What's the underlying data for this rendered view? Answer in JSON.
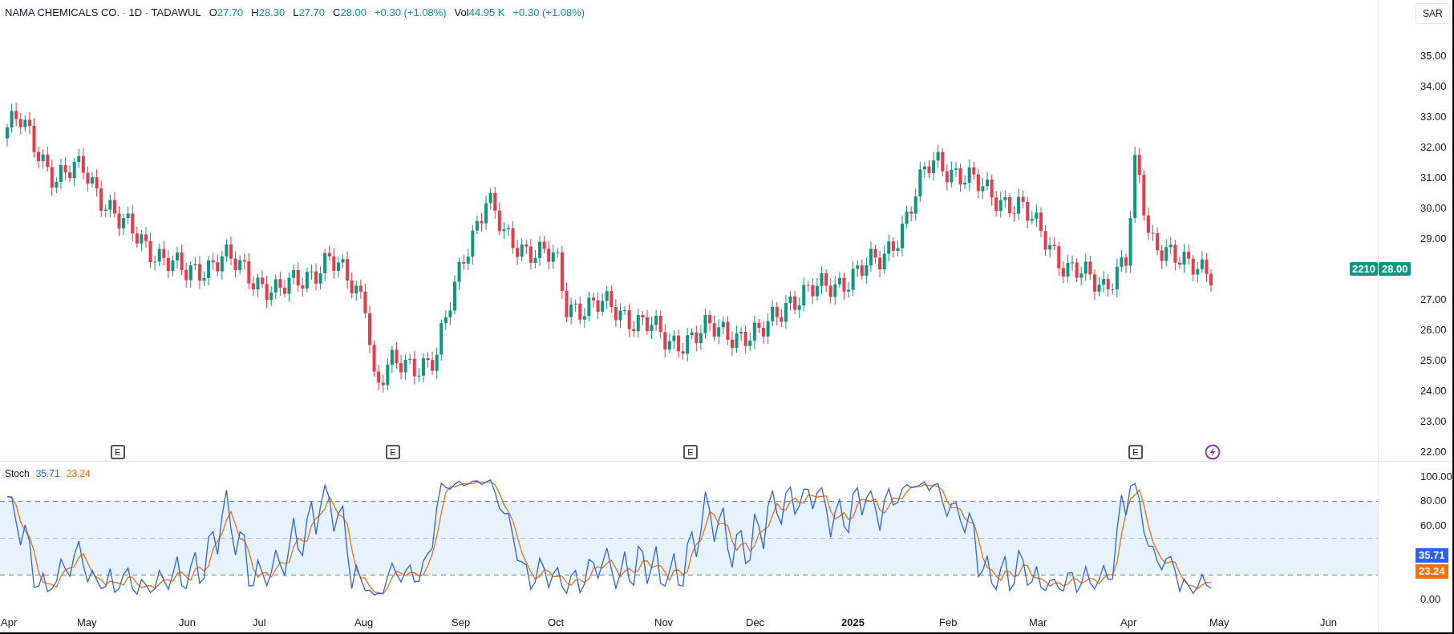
{
  "header": {
    "title": "NAMA CHEMICALS CO. · 1D · TADAWUL",
    "ohlc": [
      {
        "label": "O",
        "value": "27.70"
      },
      {
        "label": "H",
        "value": "28.30"
      },
      {
        "label": "L",
        "value": "27.70"
      },
      {
        "label": "C",
        "value": "28.00"
      }
    ],
    "change": "+0.30 (+1.08%)",
    "volume": {
      "label": "Vol",
      "value": "44.95 K",
      "change": "+0.30 (+1.08%)"
    }
  },
  "currency_button": "SAR",
  "price_axis": {
    "ticks": [
      "35.00",
      "34.00",
      "33.00",
      "32.00",
      "31.00",
      "30.00",
      "29.00",
      "27.00",
      "26.00",
      "25.00",
      "24.00",
      "23.00",
      "22.00"
    ],
    "last_price": {
      "price": "28.00",
      "volume": "2210",
      "color": "#089981"
    }
  },
  "events": [
    {
      "label": "E"
    },
    {
      "label": "E"
    },
    {
      "label": "E"
    },
    {
      "label": "E"
    }
  ],
  "stochastic": {
    "title": "Stoch",
    "k": {
      "value": "35.71",
      "color": "#2962ff"
    },
    "d": {
      "value": "23.24",
      "color": "#ff6d00"
    },
    "ticks": [
      "100.00",
      "80.00",
      "60.00",
      "0.00"
    ],
    "badges": [
      {
        "value": "35.71",
        "color": "#2962ff"
      },
      {
        "value": "23.24",
        "color": "#ff6d00"
      }
    ]
  },
  "x_axis": {
    "labels": [
      {
        "text": "Apr",
        "kind": "month"
      },
      {
        "text": "May",
        "kind": "month"
      },
      {
        "text": "Jun",
        "kind": "month"
      },
      {
        "text": "Jul",
        "kind": "month"
      },
      {
        "text": "Aug",
        "kind": "month"
      },
      {
        "text": "Sep",
        "kind": "month"
      },
      {
        "text": "Oct",
        "kind": "month"
      },
      {
        "text": "Nov",
        "kind": "month"
      },
      {
        "text": "Dec",
        "kind": "month"
      },
      {
        "text": "2025",
        "kind": "year"
      },
      {
        "text": "Feb",
        "kind": "month"
      },
      {
        "text": "Mar",
        "kind": "month"
      },
      {
        "text": "Apr",
        "kind": "month"
      },
      {
        "text": "May",
        "kind": "month"
      },
      {
        "text": "Jun",
        "kind": "month"
      }
    ]
  }
}
